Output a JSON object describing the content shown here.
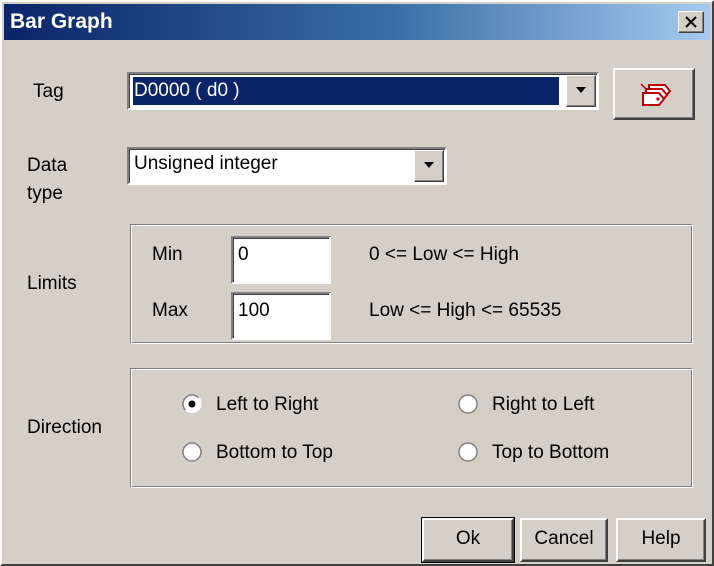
{
  "window": {
    "title": "Bar Graph"
  },
  "tag": {
    "label": "Tag",
    "value": "D0000 ( d0 )"
  },
  "data_type": {
    "label_line1": "Data",
    "label_line2": "type",
    "value": "Unsigned integer"
  },
  "limits": {
    "label": "Limits",
    "min_label": "Min",
    "min_value": "0",
    "min_hint": "0 <= Low <= High",
    "max_label": "Max",
    "max_value": "100",
    "max_hint": "Low <= High <= 65535"
  },
  "direction": {
    "label": "Direction",
    "options": [
      {
        "label": "Left to Right",
        "selected": true
      },
      {
        "label": "Right to Left",
        "selected": false
      },
      {
        "label": "Bottom to Top",
        "selected": false
      },
      {
        "label": "Top to Bottom",
        "selected": false
      }
    ]
  },
  "buttons": {
    "ok": "Ok",
    "cancel": "Cancel",
    "help": "Help"
  }
}
